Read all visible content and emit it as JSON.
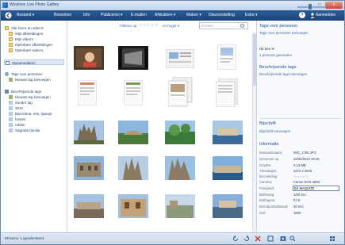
{
  "window": {
    "title": "Windows Live Photo Gallery",
    "min_label": "–",
    "max_label": "□",
    "close_label": "x"
  },
  "menu": {
    "items": [
      {
        "label": "Bestand ▾"
      },
      {
        "label": "Bewerken"
      },
      {
        "label": "Info"
      },
      {
        "label": "Publiceren ▾"
      },
      {
        "label": "E-mailen"
      },
      {
        "label": "Afdrukken ▾"
      },
      {
        "label": "Maken ▾"
      },
      {
        "label": "Diavoorstelling"
      },
      {
        "label": "Extra ▾"
      }
    ],
    "help_label": "?",
    "signin_label": "Aanmelden"
  },
  "nav": {
    "items": [
      {
        "label": "Alle foto's en video's"
      },
      {
        "label": "Mijn afbeeldingen"
      },
      {
        "label": "Mijn video's"
      },
      {
        "label": "Openbare afbeeldingen"
      },
      {
        "label": "Openbare video's"
      },
      {
        "label": "Opnamedatum"
      },
      {
        "label": "Tags voor personen"
      },
      {
        "label": "Nieuwe tag toevoegen"
      },
      {
        "label": "Beschrijvende tags"
      },
      {
        "label": "Nieuwe tag toevoegen"
      },
      {
        "label": "Zonder tag"
      },
      {
        "label": "2010"
      },
      {
        "label": "Barcelona, reis, Spanje"
      },
      {
        "label": "fontein"
      },
      {
        "label": "robbie"
      },
      {
        "label": "Sagrada familia"
      }
    ]
  },
  "toolbar": {
    "filter_label": "Filteren op:",
    "stars": "☆☆☆☆☆",
    "higher_label": "en hoger ▾",
    "search_placeholder": "Zoeken"
  },
  "pane": {
    "people_title": "Tags voor personen",
    "people_add": "Tags voor personen toevoegen",
    "people_who": "Dit ben ik",
    "people_suggest": "1 persoon gevonden",
    "desc_title": "Beschrijvende tags",
    "desc_add": "Beschrijvende tags toevoegen",
    "caption_title": "Bijschrift",
    "caption_add": "Bijschrift toevoegen",
    "info_title": "Informatie",
    "info": [
      {
        "label": "Bestandsnaam:",
        "value": "IMG_1790.JPG"
      },
      {
        "label": "Genomen op:",
        "value": "18/03/2010  20:45"
      },
      {
        "label": "Grootte:",
        "value": "3.13 MB"
      },
      {
        "label": "Afmetingen:",
        "value": "4272 x 2848"
      },
      {
        "label": "Beoordeling:",
        "value": "☆☆☆☆☆"
      },
      {
        "label": "Camera:",
        "value": "Canon EOS 450D"
      },
      {
        "label": "Fotograaf:",
        "value": "bxl MAQUOD"
      },
      {
        "label": "Belichting:",
        "value": "1/60 sec."
      },
      {
        "label": "Diafragma:",
        "value": "f/2.8"
      },
      {
        "label": "Brandpuntsafstand:",
        "value": "40 mm"
      },
      {
        "label": "ISO:",
        "value": "1600"
      }
    ]
  },
  "status": {
    "text": "99 items, 1 geselecteerd"
  },
  "colors": {
    "menubar": "#1b4378",
    "accent": "#1e4f8f",
    "selection": "#dfe9f5"
  }
}
